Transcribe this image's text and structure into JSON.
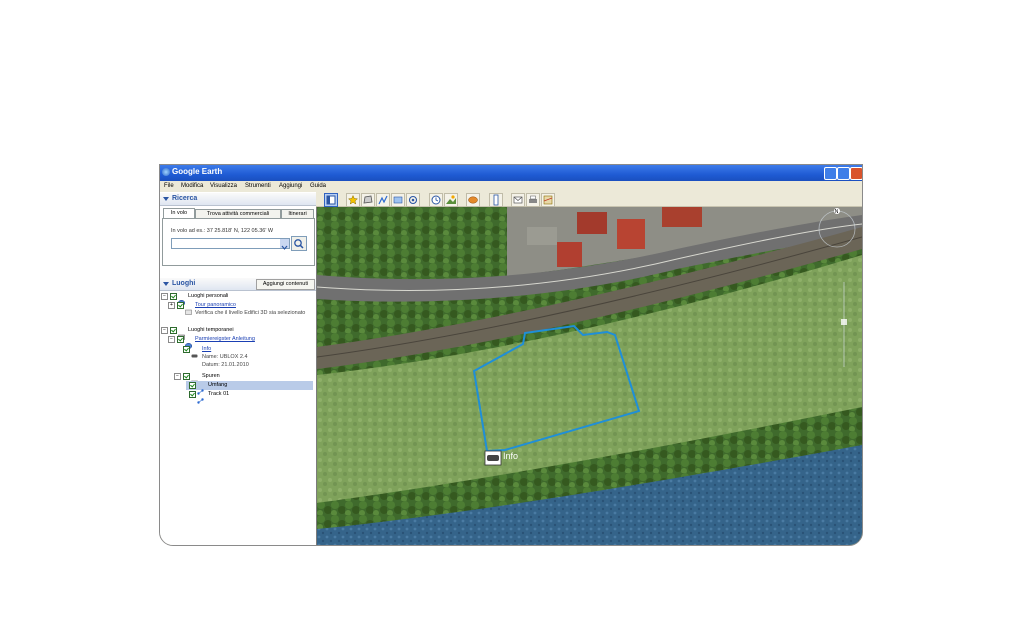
{
  "window": {
    "title": "Google Earth"
  },
  "menu": [
    "File",
    "Modifica",
    "Visualizza",
    "Strumenti",
    "Aggiungi",
    "Guida"
  ],
  "toolbar": {
    "icons": [
      "sidebar-toggle-icon",
      "placemark-icon",
      "polygon-icon",
      "path-icon",
      "image-overlay-icon",
      "record-tour-icon",
      "historical-imagery-icon",
      "sunlight-icon",
      "planets-icon",
      "ruler-icon",
      "email-icon",
      "print-icon",
      "view-in-maps-icon"
    ]
  },
  "search": {
    "header": "Ricerca",
    "tabs": [
      "In volo",
      "Trova attività commerciali",
      "Itinerari"
    ],
    "hint": "In volo ad es.: 37 25.818' N, 122 05.36' W",
    "input_value": ""
  },
  "places": {
    "header": "Luoghi",
    "add_button": "Aggiungi contenuti",
    "items": [
      {
        "label": "Luoghi personali"
      },
      {
        "label": "Tour panoramico"
      },
      {
        "label": "Verifica che il livello Edifici 3D sia selezionato"
      },
      {
        "label": "Luoghi temporanei"
      },
      {
        "label": "Parmiereigster Anleitung"
      },
      {
        "label": "Info"
      },
      {
        "label": "Name: UBLOX 2.4"
      },
      {
        "label": "Datum: 21.01.2010"
      },
      {
        "label": "Spuren"
      },
      {
        "label": "Umfang"
      },
      {
        "label": "Track 01"
      }
    ]
  },
  "map": {
    "placemark_label": "Info",
    "compass_label": "N"
  }
}
